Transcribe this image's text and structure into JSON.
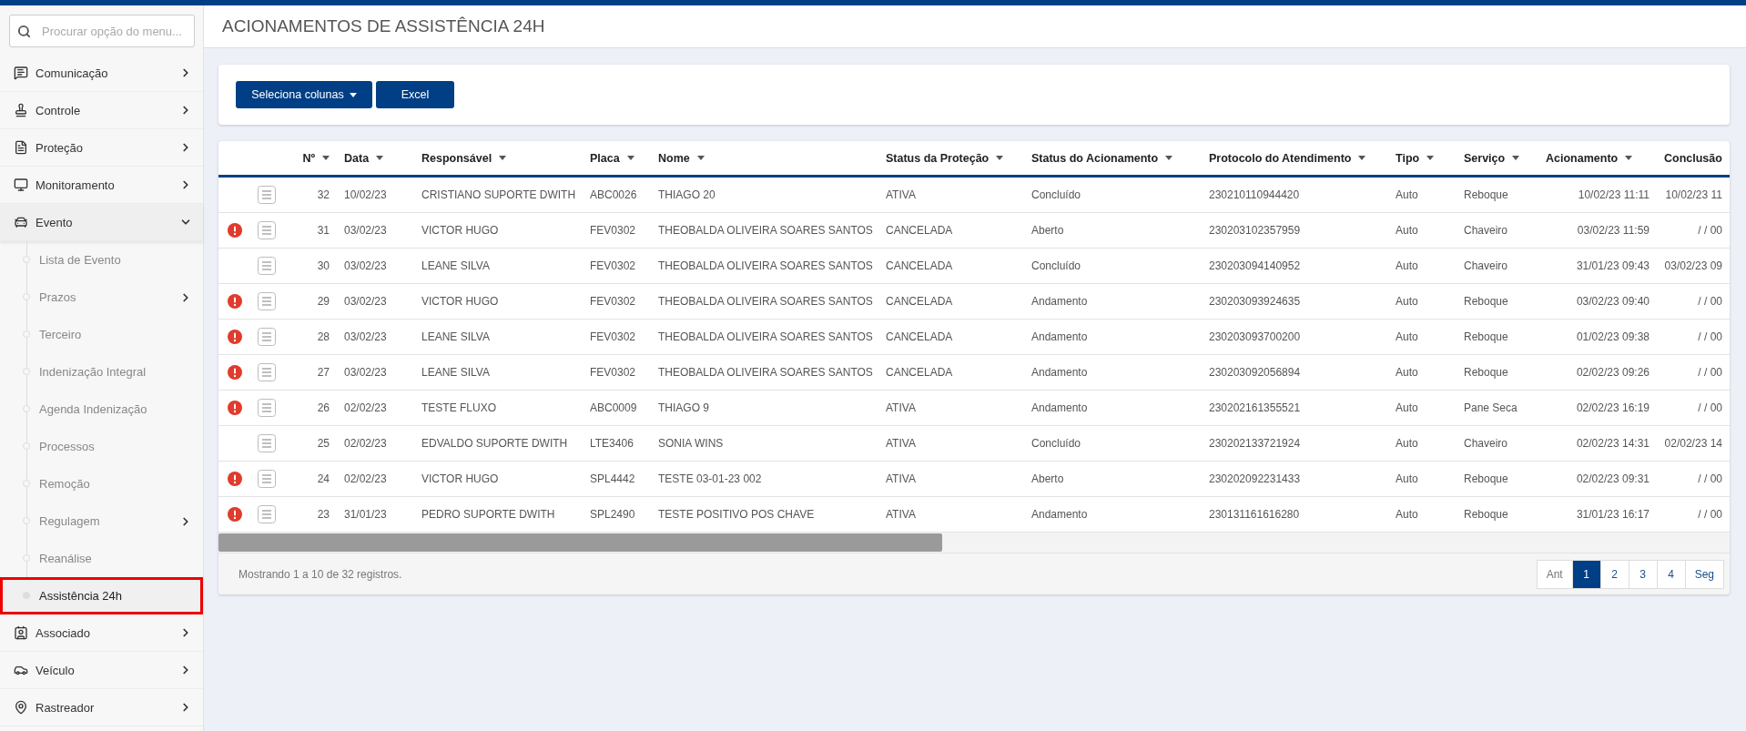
{
  "sidebar": {
    "search": {
      "placeholder": "Procurar opção do menu..."
    },
    "items": [
      {
        "label": "Comunicação",
        "expanded": false
      },
      {
        "label": "Controle",
        "expanded": false
      },
      {
        "label": "Proteção",
        "expanded": false
      },
      {
        "label": "Monitoramento",
        "expanded": false
      },
      {
        "label": "Evento",
        "expanded": true,
        "children": [
          {
            "label": "Lista de Evento",
            "selected": false
          },
          {
            "label": "Prazos",
            "selected": false,
            "expanded": false
          },
          {
            "label": "Terceiro",
            "selected": false
          },
          {
            "label": "Indenização Integral",
            "selected": false
          },
          {
            "label": "Agenda Indenização",
            "selected": false
          },
          {
            "label": "Processos",
            "selected": false
          },
          {
            "label": "Remoção",
            "selected": false
          },
          {
            "label": "Regulagem",
            "selected": false,
            "expanded": false
          },
          {
            "label": "Reanálise",
            "selected": false
          },
          {
            "label": "Assistência 24h",
            "selected": true
          }
        ]
      },
      {
        "label": "Associado",
        "expanded": false
      },
      {
        "label": "Veículo",
        "expanded": false
      },
      {
        "label": "Rastreador",
        "expanded": false
      }
    ]
  },
  "page_title": "ACIONAMENTOS DE ASSISTÊNCIA 24H",
  "toolbar": {
    "buttons": [
      {
        "label": "Seleciona colunas",
        "kind": "dropdown"
      },
      {
        "label": "Excel",
        "kind": "plain"
      }
    ]
  },
  "table": {
    "columns": [
      {
        "label": "Nº",
        "sortable": true
      },
      {
        "label": "Data",
        "sortable": true
      },
      {
        "label": "Responsável",
        "sortable": true
      },
      {
        "label": "Placa",
        "sortable": true
      },
      {
        "label": "Nome",
        "sortable": true
      },
      {
        "label": "Status da Proteção",
        "sortable": true
      },
      {
        "label": "Status do Acionamento",
        "sortable": true
      },
      {
        "label": "Protocolo do Atendimento",
        "sortable": true
      },
      {
        "label": "Tipo",
        "sortable": true
      },
      {
        "label": "Serviço",
        "sortable": true
      },
      {
        "label": "Acionamento",
        "sortable": true
      },
      {
        "label": "Conclusão"
      }
    ],
    "rows": [
      {
        "alert": false,
        "cells": [
          "32",
          "10/02/23",
          "CRISTIANO SUPORTE DWITH",
          "ABC0026",
          "THIAGO 20",
          "ATIVA",
          "Concluído",
          "230210110944420",
          "Auto",
          "Reboque",
          "10/02/23 11:11",
          "10/02/23 11"
        ]
      },
      {
        "alert": true,
        "cells": [
          "31",
          "03/02/23",
          "VICTOR HUGO",
          "FEV0302",
          "THEOBALDA OLIVEIRA SOARES SANTOS",
          "CANCELADA",
          "Aberto",
          "230203102357959",
          "Auto",
          "Chaveiro",
          "03/02/23 11:59",
          "/ / 00"
        ]
      },
      {
        "alert": false,
        "cells": [
          "30",
          "03/02/23",
          "LEANE SILVA",
          "FEV0302",
          "THEOBALDA OLIVEIRA SOARES SANTOS",
          "CANCELADA",
          "Concluído",
          "230203094140952",
          "Auto",
          "Chaveiro",
          "31/01/23 09:43",
          "03/02/23 09"
        ]
      },
      {
        "alert": true,
        "cells": [
          "29",
          "03/02/23",
          "VICTOR HUGO",
          "FEV0302",
          "THEOBALDA OLIVEIRA SOARES SANTOS",
          "CANCELADA",
          "Andamento",
          "230203093924635",
          "Auto",
          "Reboque",
          "03/02/23 09:40",
          "/ / 00"
        ]
      },
      {
        "alert": true,
        "cells": [
          "28",
          "03/02/23",
          "LEANE SILVA",
          "FEV0302",
          "THEOBALDA OLIVEIRA SOARES SANTOS",
          "CANCELADA",
          "Andamento",
          "230203093700200",
          "Auto",
          "Reboque",
          "01/02/23 09:38",
          "/ / 00"
        ]
      },
      {
        "alert": true,
        "cells": [
          "27",
          "03/02/23",
          "LEANE SILVA",
          "FEV0302",
          "THEOBALDA OLIVEIRA SOARES SANTOS",
          "CANCELADA",
          "Andamento",
          "230203092056894",
          "Auto",
          "Reboque",
          "02/02/23 09:26",
          "/ / 00"
        ]
      },
      {
        "alert": true,
        "cells": [
          "26",
          "02/02/23",
          "TESTE FLUXO",
          "ABC0009",
          "THIAGO 9",
          "ATIVA",
          "Andamento",
          "230202161355521",
          "Auto",
          "Pane Seca",
          "02/02/23 16:19",
          "/ / 00"
        ]
      },
      {
        "alert": false,
        "cells": [
          "25",
          "02/02/23",
          "EDVALDO SUPORTE DWITH",
          "LTE3406",
          "SONIA WINS",
          "ATIVA",
          "Concluído",
          "230202133721924",
          "Auto",
          "Chaveiro",
          "02/02/23 14:31",
          "02/02/23 14"
        ]
      },
      {
        "alert": true,
        "cells": [
          "24",
          "02/02/23",
          "VICTOR HUGO",
          "SPL4442",
          "TESTE 03-01-23 002",
          "ATIVA",
          "Aberto",
          "230202092231433",
          "Auto",
          "Reboque",
          "02/02/23 09:31",
          "/ / 00"
        ]
      },
      {
        "alert": true,
        "cells": [
          "23",
          "31/01/23",
          "PEDRO SUPORTE DWITH",
          "SPL2490",
          "TESTE POSITIVO POS CHAVE",
          "ATIVA",
          "Andamento",
          "230131161616280",
          "Auto",
          "Reboque",
          "31/01/23 16:17",
          "/ / 00"
        ]
      }
    ]
  },
  "footer": {
    "summary": "Mostrando 1 a 10 de 32 registros.",
    "pagination": [
      {
        "label": "Ant",
        "selected": false
      },
      {
        "label": "1",
        "selected": true
      },
      {
        "label": "2",
        "selected": false
      },
      {
        "label": "3",
        "selected": false
      },
      {
        "label": "4",
        "selected": false
      },
      {
        "label": "Seg",
        "selected": false
      }
    ]
  }
}
